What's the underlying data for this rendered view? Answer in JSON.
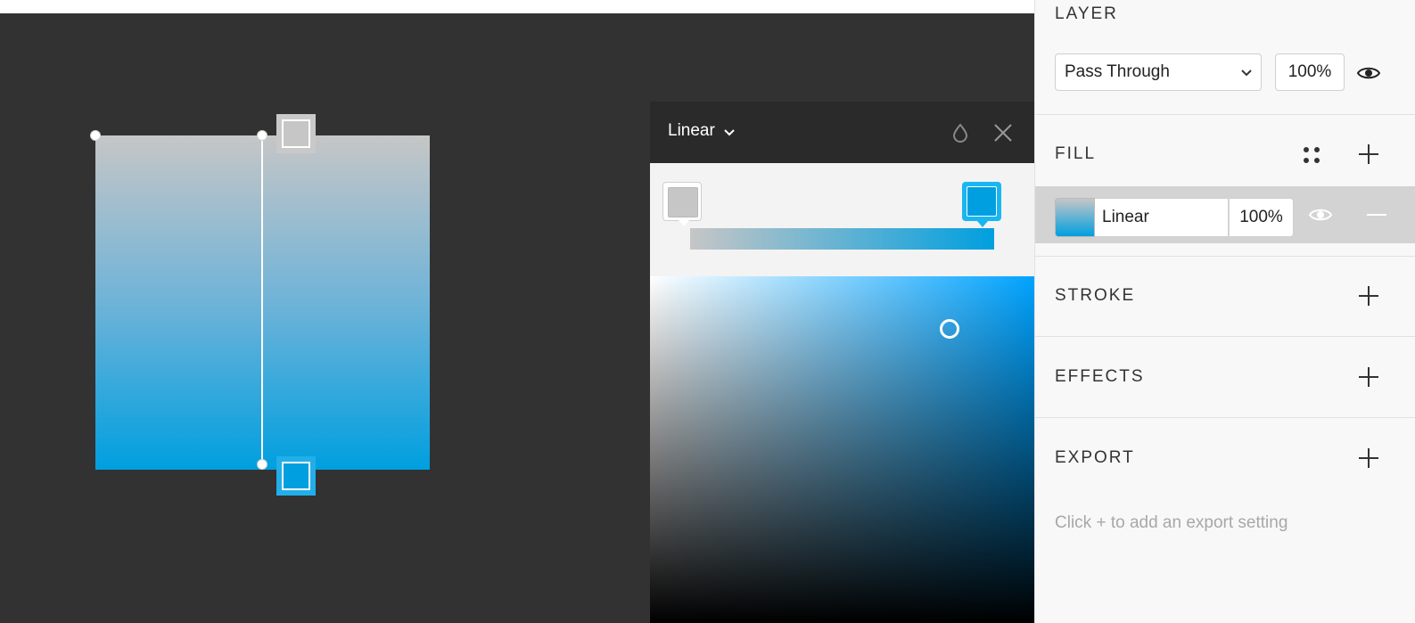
{
  "layer": {
    "title": "LAYER",
    "blend_mode": "Pass Through",
    "opacity": "100%"
  },
  "fill": {
    "title": "FILL",
    "type_label": "Linear",
    "opacity": "100%"
  },
  "stroke": {
    "title": "STROKE"
  },
  "effects": {
    "title": "EFFECTS"
  },
  "export": {
    "title": "EXPORT",
    "hint": "Click + to add an export setting"
  },
  "picker": {
    "type": "Linear",
    "stops": [
      {
        "color": "#c6c6c6"
      },
      {
        "color": "#009fdf"
      }
    ]
  },
  "colors": {
    "accent": "#009fdf",
    "gray_stop": "#c6c6c6",
    "canvas_bg": "#323232"
  },
  "icons": {
    "blend_chevron": "chevron-down-icon",
    "visibility": "eye-icon",
    "styles": "four-dots-icon",
    "add": "plus-icon",
    "remove": "minus-icon",
    "eyedropper": "drop-icon",
    "close": "close-icon"
  }
}
